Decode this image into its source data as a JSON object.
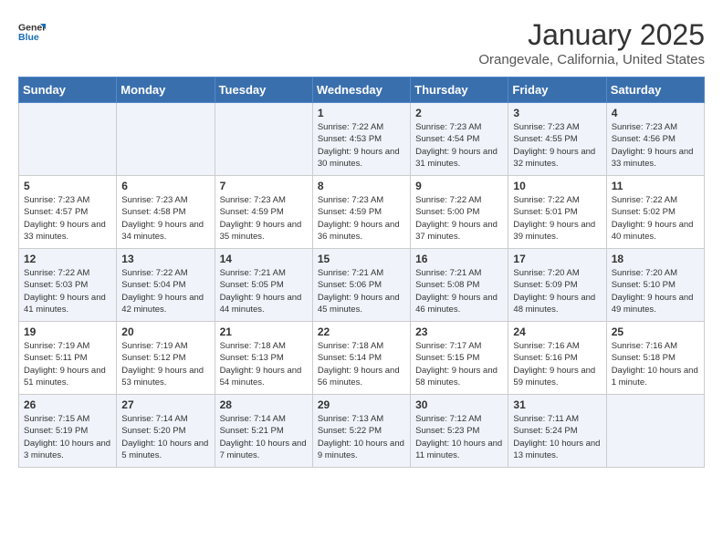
{
  "header": {
    "logo_line1": "General",
    "logo_line2": "Blue",
    "title": "January 2025",
    "subtitle": "Orangevale, California, United States"
  },
  "weekdays": [
    "Sunday",
    "Monday",
    "Tuesday",
    "Wednesday",
    "Thursday",
    "Friday",
    "Saturday"
  ],
  "weeks": [
    [
      {
        "day": "",
        "info": ""
      },
      {
        "day": "",
        "info": ""
      },
      {
        "day": "",
        "info": ""
      },
      {
        "day": "1",
        "info": "Sunrise: 7:22 AM\nSunset: 4:53 PM\nDaylight: 9 hours\nand 30 minutes."
      },
      {
        "day": "2",
        "info": "Sunrise: 7:23 AM\nSunset: 4:54 PM\nDaylight: 9 hours\nand 31 minutes."
      },
      {
        "day": "3",
        "info": "Sunrise: 7:23 AM\nSunset: 4:55 PM\nDaylight: 9 hours\nand 32 minutes."
      },
      {
        "day": "4",
        "info": "Sunrise: 7:23 AM\nSunset: 4:56 PM\nDaylight: 9 hours\nand 33 minutes."
      }
    ],
    [
      {
        "day": "5",
        "info": "Sunrise: 7:23 AM\nSunset: 4:57 PM\nDaylight: 9 hours\nand 33 minutes."
      },
      {
        "day": "6",
        "info": "Sunrise: 7:23 AM\nSunset: 4:58 PM\nDaylight: 9 hours\nand 34 minutes."
      },
      {
        "day": "7",
        "info": "Sunrise: 7:23 AM\nSunset: 4:59 PM\nDaylight: 9 hours\nand 35 minutes."
      },
      {
        "day": "8",
        "info": "Sunrise: 7:23 AM\nSunset: 4:59 PM\nDaylight: 9 hours\nand 36 minutes."
      },
      {
        "day": "9",
        "info": "Sunrise: 7:22 AM\nSunset: 5:00 PM\nDaylight: 9 hours\nand 37 minutes."
      },
      {
        "day": "10",
        "info": "Sunrise: 7:22 AM\nSunset: 5:01 PM\nDaylight: 9 hours\nand 39 minutes."
      },
      {
        "day": "11",
        "info": "Sunrise: 7:22 AM\nSunset: 5:02 PM\nDaylight: 9 hours\nand 40 minutes."
      }
    ],
    [
      {
        "day": "12",
        "info": "Sunrise: 7:22 AM\nSunset: 5:03 PM\nDaylight: 9 hours\nand 41 minutes."
      },
      {
        "day": "13",
        "info": "Sunrise: 7:22 AM\nSunset: 5:04 PM\nDaylight: 9 hours\nand 42 minutes."
      },
      {
        "day": "14",
        "info": "Sunrise: 7:21 AM\nSunset: 5:05 PM\nDaylight: 9 hours\nand 44 minutes."
      },
      {
        "day": "15",
        "info": "Sunrise: 7:21 AM\nSunset: 5:06 PM\nDaylight: 9 hours\nand 45 minutes."
      },
      {
        "day": "16",
        "info": "Sunrise: 7:21 AM\nSunset: 5:08 PM\nDaylight: 9 hours\nand 46 minutes."
      },
      {
        "day": "17",
        "info": "Sunrise: 7:20 AM\nSunset: 5:09 PM\nDaylight: 9 hours\nand 48 minutes."
      },
      {
        "day": "18",
        "info": "Sunrise: 7:20 AM\nSunset: 5:10 PM\nDaylight: 9 hours\nand 49 minutes."
      }
    ],
    [
      {
        "day": "19",
        "info": "Sunrise: 7:19 AM\nSunset: 5:11 PM\nDaylight: 9 hours\nand 51 minutes."
      },
      {
        "day": "20",
        "info": "Sunrise: 7:19 AM\nSunset: 5:12 PM\nDaylight: 9 hours\nand 53 minutes."
      },
      {
        "day": "21",
        "info": "Sunrise: 7:18 AM\nSunset: 5:13 PM\nDaylight: 9 hours\nand 54 minutes."
      },
      {
        "day": "22",
        "info": "Sunrise: 7:18 AM\nSunset: 5:14 PM\nDaylight: 9 hours\nand 56 minutes."
      },
      {
        "day": "23",
        "info": "Sunrise: 7:17 AM\nSunset: 5:15 PM\nDaylight: 9 hours\nand 58 minutes."
      },
      {
        "day": "24",
        "info": "Sunrise: 7:16 AM\nSunset: 5:16 PM\nDaylight: 9 hours\nand 59 minutes."
      },
      {
        "day": "25",
        "info": "Sunrise: 7:16 AM\nSunset: 5:18 PM\nDaylight: 10 hours\nand 1 minute."
      }
    ],
    [
      {
        "day": "26",
        "info": "Sunrise: 7:15 AM\nSunset: 5:19 PM\nDaylight: 10 hours\nand 3 minutes."
      },
      {
        "day": "27",
        "info": "Sunrise: 7:14 AM\nSunset: 5:20 PM\nDaylight: 10 hours\nand 5 minutes."
      },
      {
        "day": "28",
        "info": "Sunrise: 7:14 AM\nSunset: 5:21 PM\nDaylight: 10 hours\nand 7 minutes."
      },
      {
        "day": "29",
        "info": "Sunrise: 7:13 AM\nSunset: 5:22 PM\nDaylight: 10 hours\nand 9 minutes."
      },
      {
        "day": "30",
        "info": "Sunrise: 7:12 AM\nSunset: 5:23 PM\nDaylight: 10 hours\nand 11 minutes."
      },
      {
        "day": "31",
        "info": "Sunrise: 7:11 AM\nSunset: 5:24 PM\nDaylight: 10 hours\nand 13 minutes."
      },
      {
        "day": "",
        "info": ""
      }
    ]
  ]
}
